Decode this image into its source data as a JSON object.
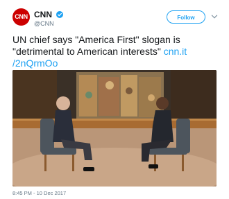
{
  "account": {
    "name": "CNN",
    "handle": "@CNN",
    "avatar_text": "CNN",
    "brand_color": "#cc0000",
    "verified": true
  },
  "actions": {
    "follow_label": "Follow",
    "more_icon": "chevron-down-icon"
  },
  "tweet": {
    "text": "UN chief says \"America First\" slogan is \"detrimental to American interests\"",
    "link_text": "cnn.it /2nQrmOo",
    "link_color": "#1da1f2"
  },
  "media": {
    "description_icon": "video-still-image"
  },
  "timestamp": "8:45 PM - 10 Dec 2017"
}
